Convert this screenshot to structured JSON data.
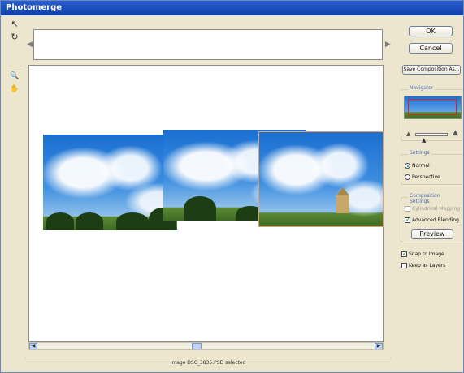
{
  "window": {
    "title": "Photomerge"
  },
  "toolbar": {
    "tools": [
      {
        "icon": "select-image-icon",
        "glyph": "↖"
      },
      {
        "icon": "rotate-image-icon",
        "glyph": "↻"
      },
      {
        "icon": "zoom-icon",
        "glyph": "🔍"
      },
      {
        "icon": "hand-icon",
        "glyph": "✋"
      }
    ]
  },
  "buttons": {
    "ok": "OK",
    "cancel": "Cancel",
    "save_composition": "Save Composition As...",
    "preview": "Preview"
  },
  "navigator": {
    "title": "Navigator"
  },
  "settings": {
    "title": "Settings",
    "options": [
      {
        "label": "Normal",
        "selected": true
      },
      {
        "label": "Perspective",
        "selected": false
      }
    ]
  },
  "composition_settings": {
    "title": "Composition Settings",
    "options": [
      {
        "label": "Cylindrical Mapping",
        "checked": false,
        "enabled": false
      },
      {
        "label": "Advanced Blending",
        "checked": true,
        "enabled": true
      }
    ]
  },
  "bottom_options": [
    {
      "label": "Snap to Image",
      "checked": true
    },
    {
      "label": "Keep as Layers",
      "checked": false
    }
  ],
  "status": {
    "text": "Image DSC_3835.PSD selected"
  },
  "colors": {
    "titlebar": "#1f4fc0",
    "panel": "#ece6cf",
    "group_title": "#4d6bb0"
  }
}
